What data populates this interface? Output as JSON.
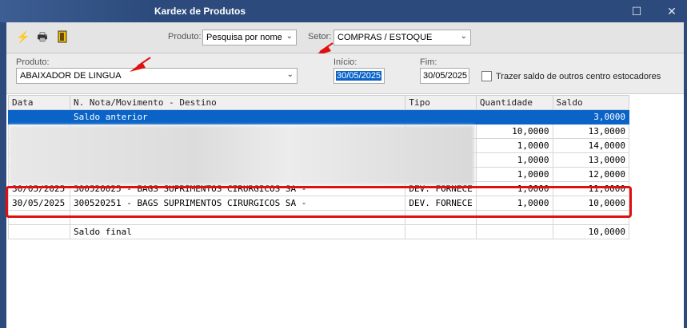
{
  "window": {
    "title": "Kardex de Produtos",
    "maximize_symbol": "☐",
    "close_symbol": "✕"
  },
  "toolbar": {
    "icons": [
      "lightning-icon",
      "printer-icon",
      "exit-door-icon"
    ],
    "produto_label": "Produto:",
    "produto_mode": "Pesquisa por nome",
    "setor_label": "Setor:",
    "setor_value": "COMPRAS / ESTOQUE"
  },
  "filters": {
    "produto_label": "Produto:",
    "produto_value": "ABAIXADOR DE LINGUA",
    "inicio_label": "Início:",
    "inicio_value": "30/05/2025",
    "fim_label": "Fim:",
    "fim_value": "30/05/2025",
    "checkbox_label": "Trazer saldo de outros centro estocadores",
    "checkbox_checked": false
  },
  "grid": {
    "columns": [
      "Data",
      "N. Nota/Movimento - Destino",
      "Tipo",
      "Quantidade",
      "Saldo"
    ],
    "rows": [
      {
        "data": "",
        "movimento": "Saldo anterior",
        "tipo": "",
        "quantidade": "",
        "saldo": "3,0000"
      },
      {
        "data": "",
        "movimento": "",
        "tipo": "",
        "quantidade": "10,0000",
        "saldo": "13,0000"
      },
      {
        "data": "",
        "movimento": "",
        "tipo": "",
        "quantidade": "1,0000",
        "saldo": "14,0000"
      },
      {
        "data": "",
        "movimento": "",
        "tipo": "",
        "quantidade": "1,0000",
        "saldo": "13,0000"
      },
      {
        "data": "",
        "movimento": "",
        "tipo": "",
        "quantidade": "1,0000",
        "saldo": "12,0000"
      },
      {
        "data": "30/05/2025",
        "movimento": "300520025  - BAGS SUPRIMENTOS CIRURGICOS SA -",
        "tipo": "DEV. FORNECE",
        "quantidade": "1,0000",
        "saldo": "11,0000"
      },
      {
        "data": "30/05/2025",
        "movimento": "300520251  - BAGS SUPRIMENTOS CIRURGICOS SA -",
        "tipo": "DEV. FORNECE",
        "quantidade": "1,0000",
        "saldo": "10,0000"
      },
      {
        "data": "",
        "movimento": "",
        "tipo": "",
        "quantidade": "",
        "saldo": ""
      },
      {
        "data": "",
        "movimento": "Saldo final",
        "tipo": "",
        "quantidade": "",
        "saldo": "10,0000"
      }
    ]
  },
  "colors": {
    "titlebar": "#2c4b7c",
    "selection": "#0a64c8",
    "highlight": "#e01010"
  }
}
